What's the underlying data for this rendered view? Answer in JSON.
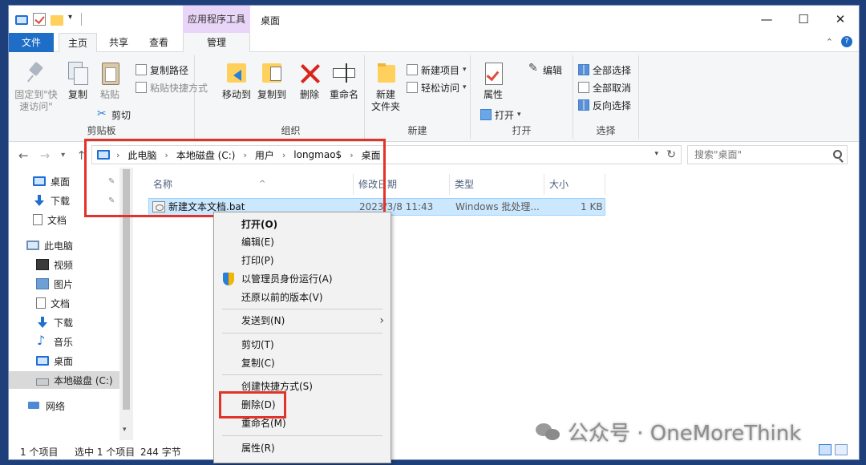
{
  "titlebar": {
    "context_tab_group": "应用程序工具",
    "window_title": "桌面",
    "minimize": "—",
    "maximize": "☐",
    "close": "✕"
  },
  "tabs": {
    "file": "文件",
    "home": "主页",
    "share": "共享",
    "view": "查看",
    "manage": "管理"
  },
  "ribbon": {
    "clipboard": {
      "pin_quick_line1": "固定到\"快",
      "pin_quick_line2": "速访问\"",
      "copy": "复制",
      "paste": "粘贴",
      "copy_path": "复制路径",
      "paste_shortcut": "粘贴快捷方式",
      "cut": "剪切",
      "label": "剪贴板"
    },
    "organize": {
      "move_to": "移动到",
      "copy_to": "复制到",
      "delete": "删除",
      "rename": "重命名",
      "label": "组织"
    },
    "new": {
      "new_folder_line1": "新建",
      "new_folder_line2": "文件夹",
      "new_item": "新建项目",
      "easy_access": "轻松访问",
      "label": "新建"
    },
    "open": {
      "properties": "属性",
      "open": "打开",
      "edit": "编辑",
      "label": "打开"
    },
    "select": {
      "select_all": "全部选择",
      "select_none": "全部取消",
      "invert": "反向选择",
      "label": "选择"
    }
  },
  "address": {
    "crumbs": [
      "此电脑",
      "本地磁盘 (C:)",
      "用户",
      "longmao$",
      "桌面"
    ],
    "search_placeholder": "搜索\"桌面\""
  },
  "sidebar": {
    "items": [
      {
        "label": "桌面",
        "icon": "desktop-icon"
      },
      {
        "label": "下载",
        "icon": "download-icon"
      },
      {
        "label": "文档",
        "icon": "document-icon"
      },
      {
        "label": "此电脑",
        "icon": "computer-icon"
      },
      {
        "label": "视频",
        "icon": "video-icon"
      },
      {
        "label": "图片",
        "icon": "picture-icon"
      },
      {
        "label": "文档",
        "icon": "document-icon"
      },
      {
        "label": "下载",
        "icon": "download-icon"
      },
      {
        "label": "音乐",
        "icon": "music-icon"
      },
      {
        "label": "桌面",
        "icon": "desktop-icon"
      },
      {
        "label": "本地磁盘 (C:)",
        "icon": "disk-icon"
      },
      {
        "label": "网络",
        "icon": "network-icon"
      }
    ]
  },
  "filelist": {
    "columns": {
      "name": "名称",
      "modified": "修改日期",
      "type": "类型",
      "size": "大小"
    },
    "rows": [
      {
        "name": "新建文本文档.bat",
        "modified": "2023/3/8 11:43",
        "type": "Windows 批处理...",
        "size": "1 KB"
      }
    ]
  },
  "status": {
    "count": "1 个项目",
    "selected": "选中 1 个项目",
    "size": "244 字节"
  },
  "context_menu": {
    "items": [
      "打开(O)",
      "编辑(E)",
      "打印(P)",
      "以管理员身份运行(A)",
      "还原以前的版本(V)",
      "发送到(N)",
      "剪切(T)",
      "复制(C)",
      "创建快捷方式(S)",
      "删除(D)",
      "重命名(M)",
      "属性(R)"
    ]
  },
  "watermark": {
    "text": "公众号 · OneMoreThink"
  },
  "colors": {
    "accent": "#1e6ec8",
    "highlight_red": "#e2332a",
    "selection": "#cce8ff",
    "desktop_bg": "#1f3f7a"
  }
}
